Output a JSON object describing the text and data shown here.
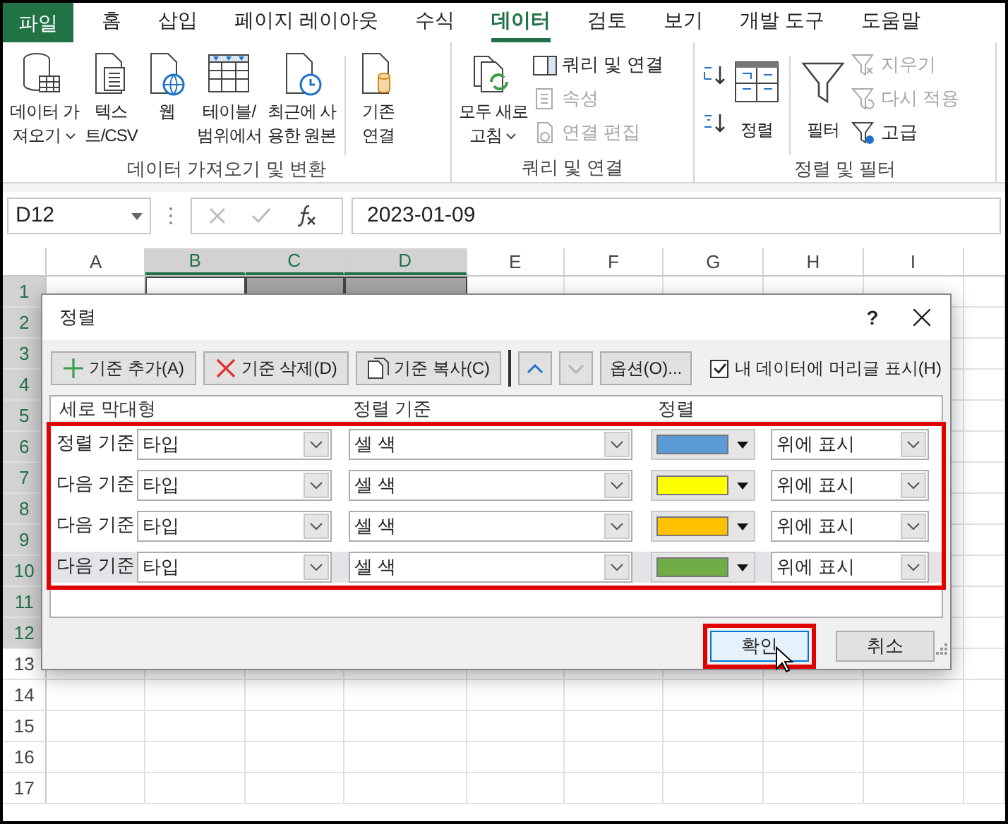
{
  "menu_tabs": [
    {
      "label": "파일",
      "kind": "file",
      "selected": false
    },
    {
      "label": "홈",
      "kind": "tab",
      "selected": false
    },
    {
      "label": "삽입",
      "kind": "tab",
      "selected": false
    },
    {
      "label": "페이지 레이아웃",
      "kind": "tab",
      "selected": false
    },
    {
      "label": "수식",
      "kind": "tab",
      "selected": false
    },
    {
      "label": "데이터",
      "kind": "tab",
      "selected": true
    },
    {
      "label": "검토",
      "kind": "tab",
      "selected": false
    },
    {
      "label": "보기",
      "kind": "tab",
      "selected": false
    },
    {
      "label": "개발 도구",
      "kind": "tab",
      "selected": false
    },
    {
      "label": "도움말",
      "kind": "tab",
      "selected": false
    }
  ],
  "ribbon": {
    "groups": [
      {
        "label": "데이터 가져오기 및 변환",
        "items": [
          {
            "kind": "large",
            "label": "데이터 가\n져오기",
            "dropdown": true
          },
          {
            "kind": "large",
            "label": "텍스\n트/CSV"
          },
          {
            "kind": "large",
            "label": "웹"
          },
          {
            "kind": "large",
            "label": "테이블/\n범위에서"
          },
          {
            "kind": "large",
            "label": "최근에 사\n용한 원본"
          },
          {
            "kind": "large",
            "label": "기존\n연결",
            "separator_before": true
          }
        ]
      },
      {
        "label": "쿼리 및 연결",
        "items": [
          {
            "kind": "large",
            "label": "모두 새로\n고침",
            "dropdown": true
          },
          {
            "kind": "small",
            "label": "쿼리 및 연결",
            "disabled": false
          },
          {
            "kind": "small",
            "label": "속성",
            "disabled": true
          },
          {
            "kind": "small",
            "label": "연결 편집",
            "disabled": true
          }
        ]
      },
      {
        "label": "정렬 및 필터",
        "items": [
          {
            "kind": "icon"
          },
          {
            "kind": "icon"
          },
          {
            "kind": "large",
            "label": "정렬"
          },
          {
            "kind": "large",
            "label": "필터",
            "separator_before": true
          },
          {
            "kind": "small",
            "label": "지우기",
            "disabled": true
          },
          {
            "kind": "small",
            "label": "다시 적용",
            "disabled": true
          },
          {
            "kind": "small",
            "label": "고급",
            "disabled": false
          }
        ]
      }
    ]
  },
  "formula_bar": {
    "name_box": "D12",
    "formula": "2023-01-09"
  },
  "sheet": {
    "columns": [
      {
        "label": "A",
        "selected": false
      },
      {
        "label": "B",
        "selected": true
      },
      {
        "label": "C",
        "selected": true
      },
      {
        "label": "D",
        "selected": true
      },
      {
        "label": "E",
        "selected": false
      },
      {
        "label": "F",
        "selected": false
      },
      {
        "label": "G",
        "selected": false
      },
      {
        "label": "H",
        "selected": false
      },
      {
        "label": "I",
        "selected": false
      }
    ],
    "rows": [
      {
        "label": "1",
        "selected": true
      },
      {
        "label": "2",
        "selected": true
      },
      {
        "label": "3",
        "selected": true
      },
      {
        "label": "4",
        "selected": true
      },
      {
        "label": "5",
        "selected": true
      },
      {
        "label": "6",
        "selected": true
      },
      {
        "label": "7",
        "selected": true
      },
      {
        "label": "8",
        "selected": true
      },
      {
        "label": "9",
        "selected": true
      },
      {
        "label": "10",
        "selected": true
      },
      {
        "label": "11",
        "selected": true
      },
      {
        "label": "12",
        "selected": true
      },
      {
        "label": "13",
        "selected": false
      },
      {
        "label": "14",
        "selected": false
      },
      {
        "label": "15",
        "selected": false
      },
      {
        "label": "16",
        "selected": false
      },
      {
        "label": "17",
        "selected": false
      }
    ],
    "header_cells": [
      {
        "color": "#ffffff"
      },
      {
        "color": "#a6a6a6"
      },
      {
        "color": "#a6a6a6"
      }
    ]
  },
  "dialog": {
    "title": "정렬",
    "help": "?",
    "toolbar": [
      {
        "kind": "add",
        "label": "기준 추가(A)"
      },
      {
        "kind": "delete",
        "label": "기준 삭제(D)"
      },
      {
        "kind": "copy",
        "label": "기준 복사(C)"
      },
      {
        "kind": "up",
        "disabled": false
      },
      {
        "kind": "down",
        "disabled": true
      },
      {
        "kind": "text",
        "label": "옵션(O)..."
      }
    ],
    "header_checkbox": {
      "label": "내 데이터에 머리글 표시(H)",
      "checked": true
    },
    "columns": [
      "세로 막대형",
      "정렬 기준",
      "정렬"
    ],
    "levels_highlighted": true,
    "levels": [
      {
        "label": "정렬 기준",
        "column": "타입",
        "sort_on": "셀 색",
        "color": "#5b9bd5",
        "order": "위에 표시",
        "selected": false
      },
      {
        "label": "다음 기준",
        "column": "타입",
        "sort_on": "셀 색",
        "color": "#ffff00",
        "order": "위에 표시",
        "selected": false
      },
      {
        "label": "다음 기준",
        "column": "타입",
        "sort_on": "셀 색",
        "color": "#ffc000",
        "order": "위에 표시",
        "selected": false
      },
      {
        "label": "다음 기준",
        "column": "타입",
        "sort_on": "셀 색",
        "color": "#70ad47",
        "order": "위에 표시",
        "selected": true
      }
    ],
    "buttons": [
      {
        "label": "확인",
        "default": true,
        "highlighted": true
      },
      {
        "label": "취소",
        "default": false,
        "highlighted": false
      }
    ]
  }
}
